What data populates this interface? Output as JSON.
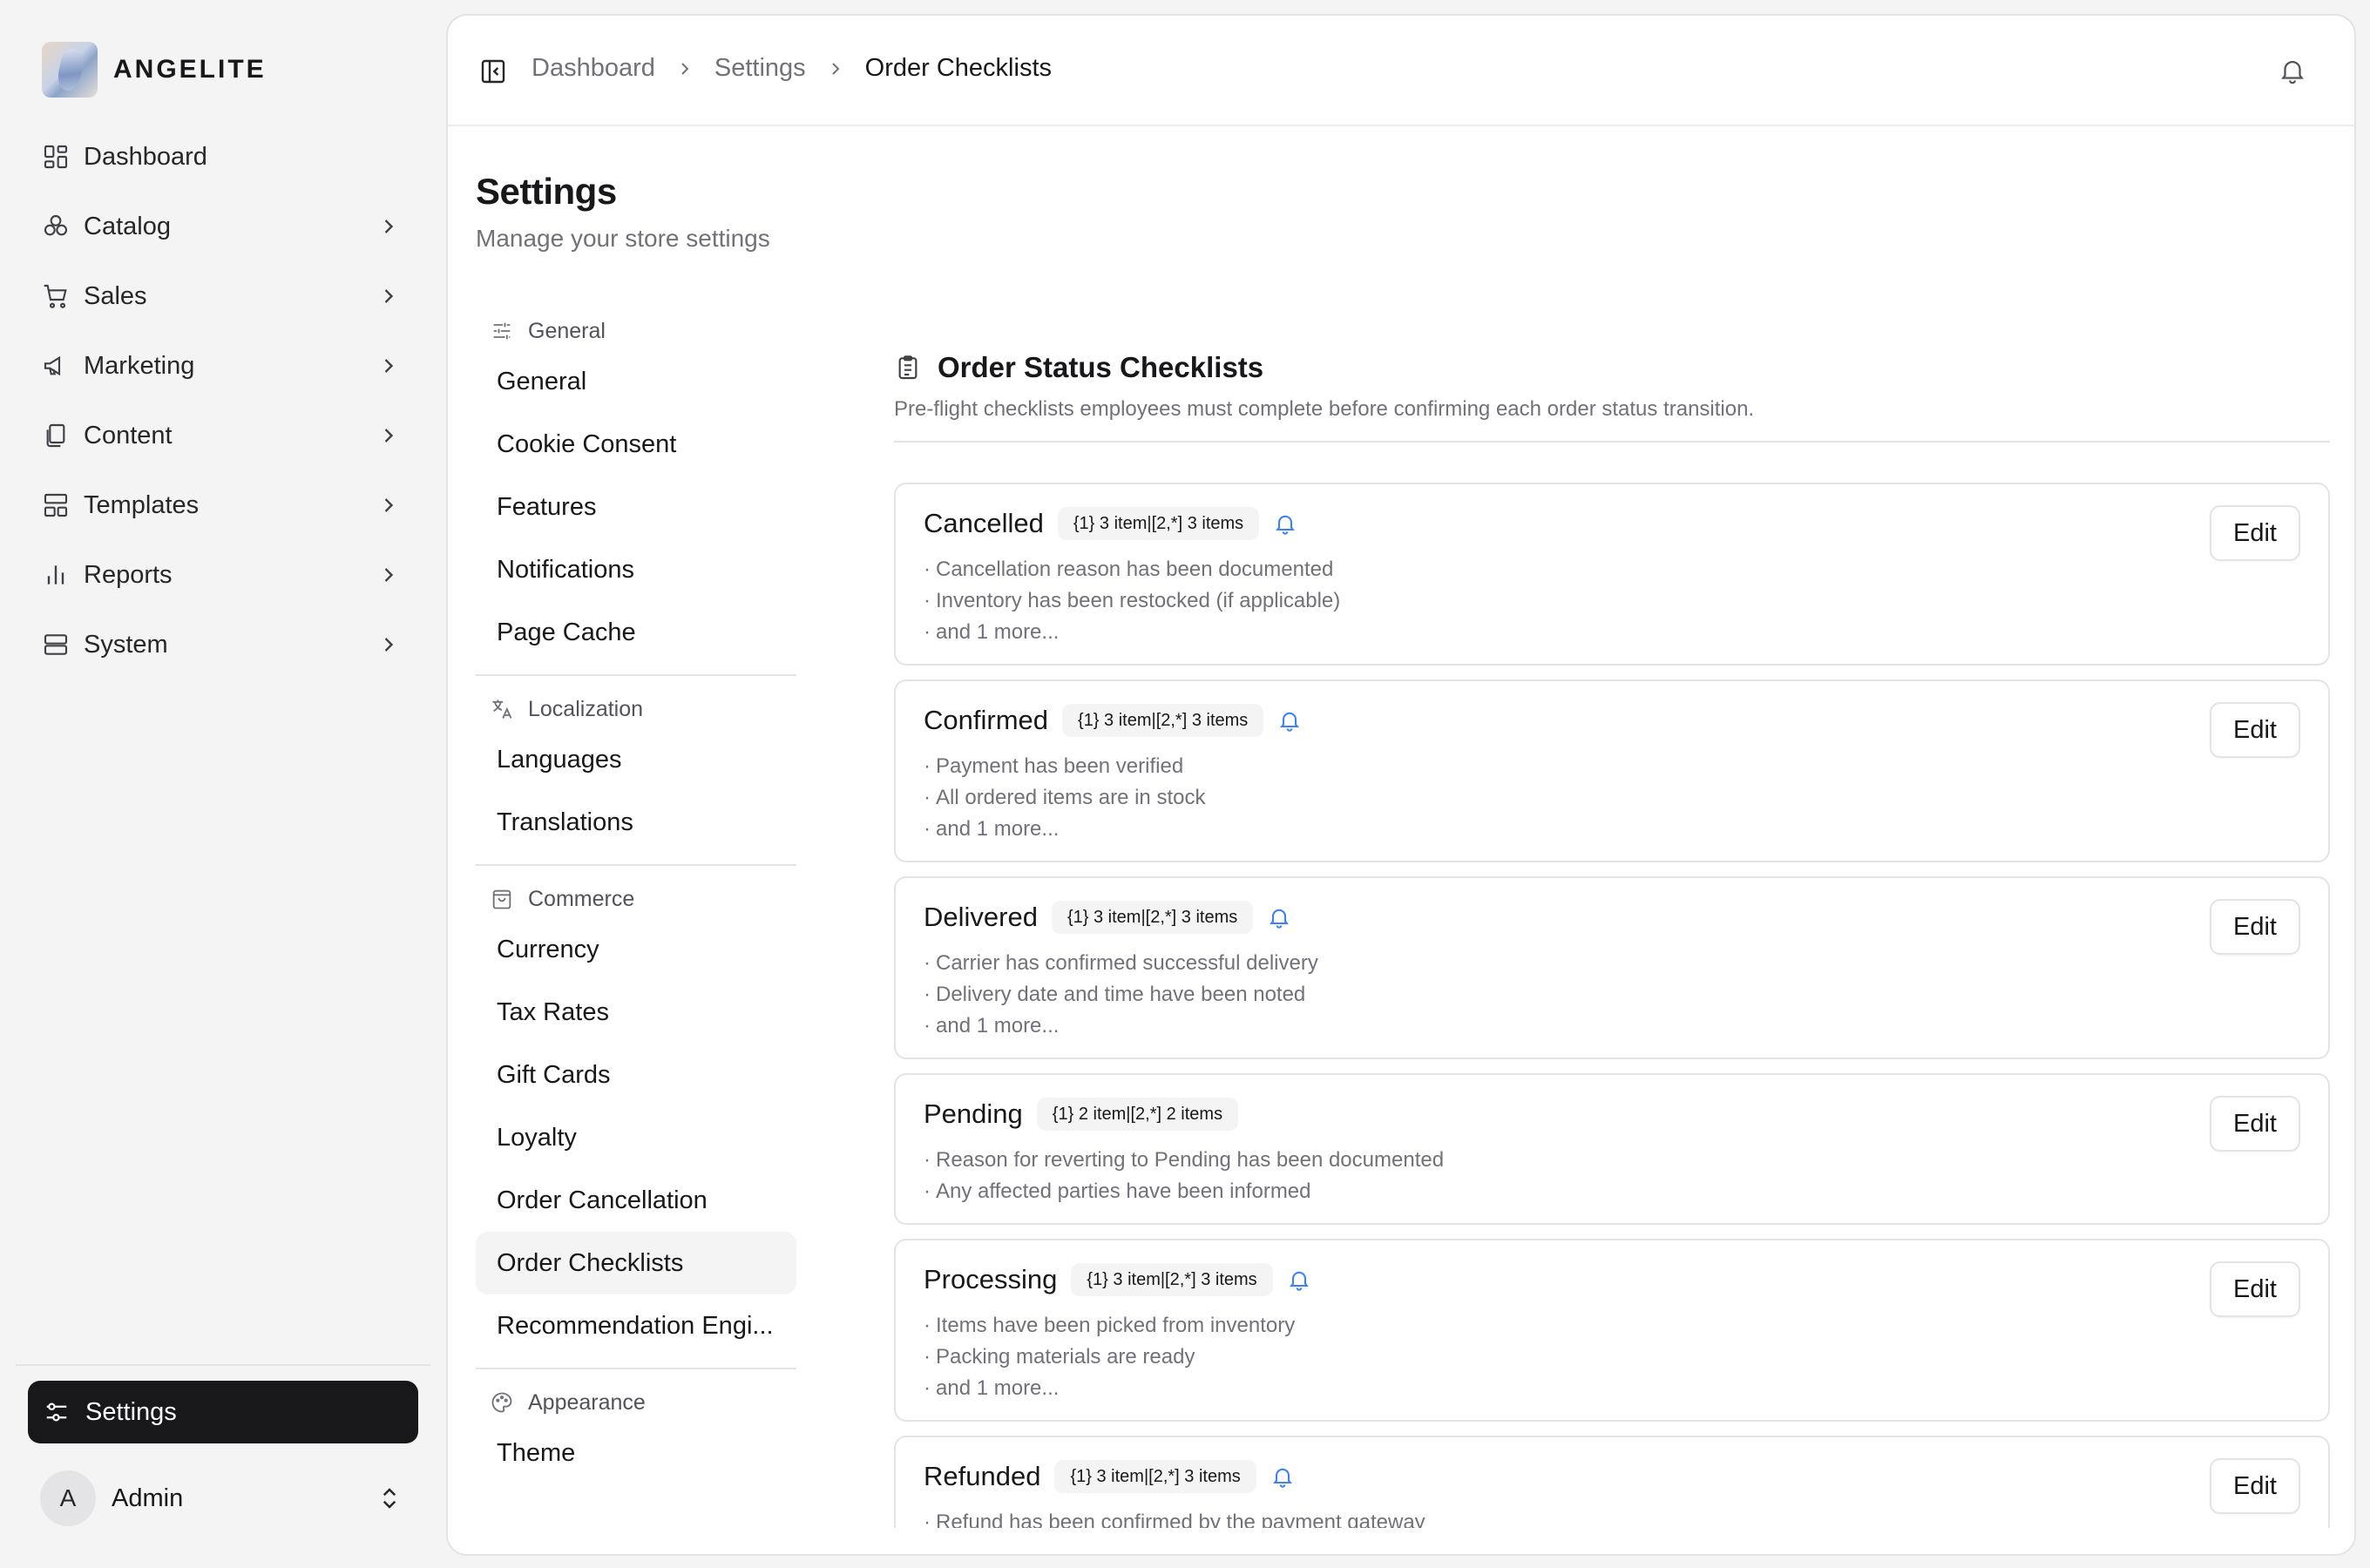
{
  "brand": {
    "name": "ANGELITE"
  },
  "nav": {
    "items": [
      {
        "label": "Dashboard",
        "icon": "dashboard-icon",
        "has_children": false
      },
      {
        "label": "Catalog",
        "icon": "catalog-icon",
        "has_children": true
      },
      {
        "label": "Sales",
        "icon": "cart-icon",
        "has_children": true
      },
      {
        "label": "Marketing",
        "icon": "megaphone-icon",
        "has_children": true
      },
      {
        "label": "Content",
        "icon": "files-icon",
        "has_children": true
      },
      {
        "label": "Templates",
        "icon": "templates-icon",
        "has_children": true
      },
      {
        "label": "Reports",
        "icon": "bar-chart-icon",
        "has_children": true
      },
      {
        "label": "System",
        "icon": "server-icon",
        "has_children": true
      }
    ],
    "settings_label": "Settings"
  },
  "user": {
    "initial": "A",
    "name": "Admin"
  },
  "breadcrumb": {
    "items": [
      "Dashboard",
      "Settings"
    ],
    "current": "Order Checklists"
  },
  "page": {
    "title": "Settings",
    "subtitle": "Manage your store settings"
  },
  "subnav": {
    "groups": [
      {
        "label": "General",
        "icon": "sliders-icon",
        "items": [
          "General",
          "Cookie Consent",
          "Features",
          "Notifications",
          "Page Cache"
        ]
      },
      {
        "label": "Localization",
        "icon": "translate-icon",
        "items": [
          "Languages",
          "Translations"
        ]
      },
      {
        "label": "Commerce",
        "icon": "shopping-bag-icon",
        "items": [
          "Currency",
          "Tax Rates",
          "Gift Cards",
          "Loyalty",
          "Order Cancellation",
          "Order Checklists",
          "Recommendation Engi..."
        ]
      },
      {
        "label": "Appearance",
        "icon": "palette-icon",
        "items": [
          "Theme"
        ]
      }
    ],
    "active": "Order Checklists"
  },
  "checklists": {
    "title": "Order Status Checklists",
    "description": "Pre-flight checklists employees must complete before confirming each order status transition.",
    "edit_label": "Edit",
    "cards": [
      {
        "name": "Cancelled",
        "badge": "{1} 3 item|[2,*] 3 items",
        "bell": true,
        "items": [
          "Cancellation reason has been documented",
          "Inventory has been restocked (if applicable)",
          "and 1 more..."
        ]
      },
      {
        "name": "Confirmed",
        "badge": "{1} 3 item|[2,*] 3 items",
        "bell": true,
        "items": [
          "Payment has been verified",
          "All ordered items are in stock",
          "and 1 more..."
        ]
      },
      {
        "name": "Delivered",
        "badge": "{1} 3 item|[2,*] 3 items",
        "bell": true,
        "items": [
          "Carrier has confirmed successful delivery",
          "Delivery date and time have been noted",
          "and 1 more..."
        ]
      },
      {
        "name": "Pending",
        "badge": "{1} 2 item|[2,*] 2 items",
        "bell": false,
        "items": [
          "Reason for reverting to Pending has been documented",
          "Any affected parties have been informed"
        ]
      },
      {
        "name": "Processing",
        "badge": "{1} 3 item|[2,*] 3 items",
        "bell": true,
        "items": [
          "Items have been picked from inventory",
          "Packing materials are ready",
          "and 1 more..."
        ]
      },
      {
        "name": "Refunded",
        "badge": "{1} 3 item|[2,*] 3 items",
        "bell": true,
        "items": [
          "Refund has been confirmed by the payment gateway"
        ]
      }
    ]
  }
}
